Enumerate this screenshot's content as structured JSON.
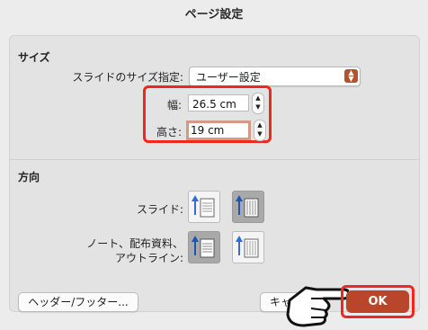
{
  "dialog": {
    "title": "ページ設定"
  },
  "size_section": {
    "title": "サイズ",
    "slide_size_label": "スライドのサイズ指定:",
    "slide_size_value": "ユーザー設定",
    "width_label": "幅:",
    "width_value": "26.5 cm",
    "height_label": "高さ:",
    "height_value": "19 cm"
  },
  "orientation_section": {
    "title": "方向",
    "slides_label": "スライド:",
    "notes_label_line1": "ノート、配布資料、",
    "notes_label_line2": "アウトライン:"
  },
  "footer": {
    "header_footer_button": "ヘッダー/フッター...",
    "cancel_button": "キャ",
    "ok_button": "OK"
  },
  "colors": {
    "accent": "#b9462a",
    "highlight": "#f0261f"
  },
  "icons": [
    "chevron-up-down-icon",
    "stepper-icon",
    "portrait-icon",
    "landscape-icon",
    "pointing-hand-icon"
  ]
}
